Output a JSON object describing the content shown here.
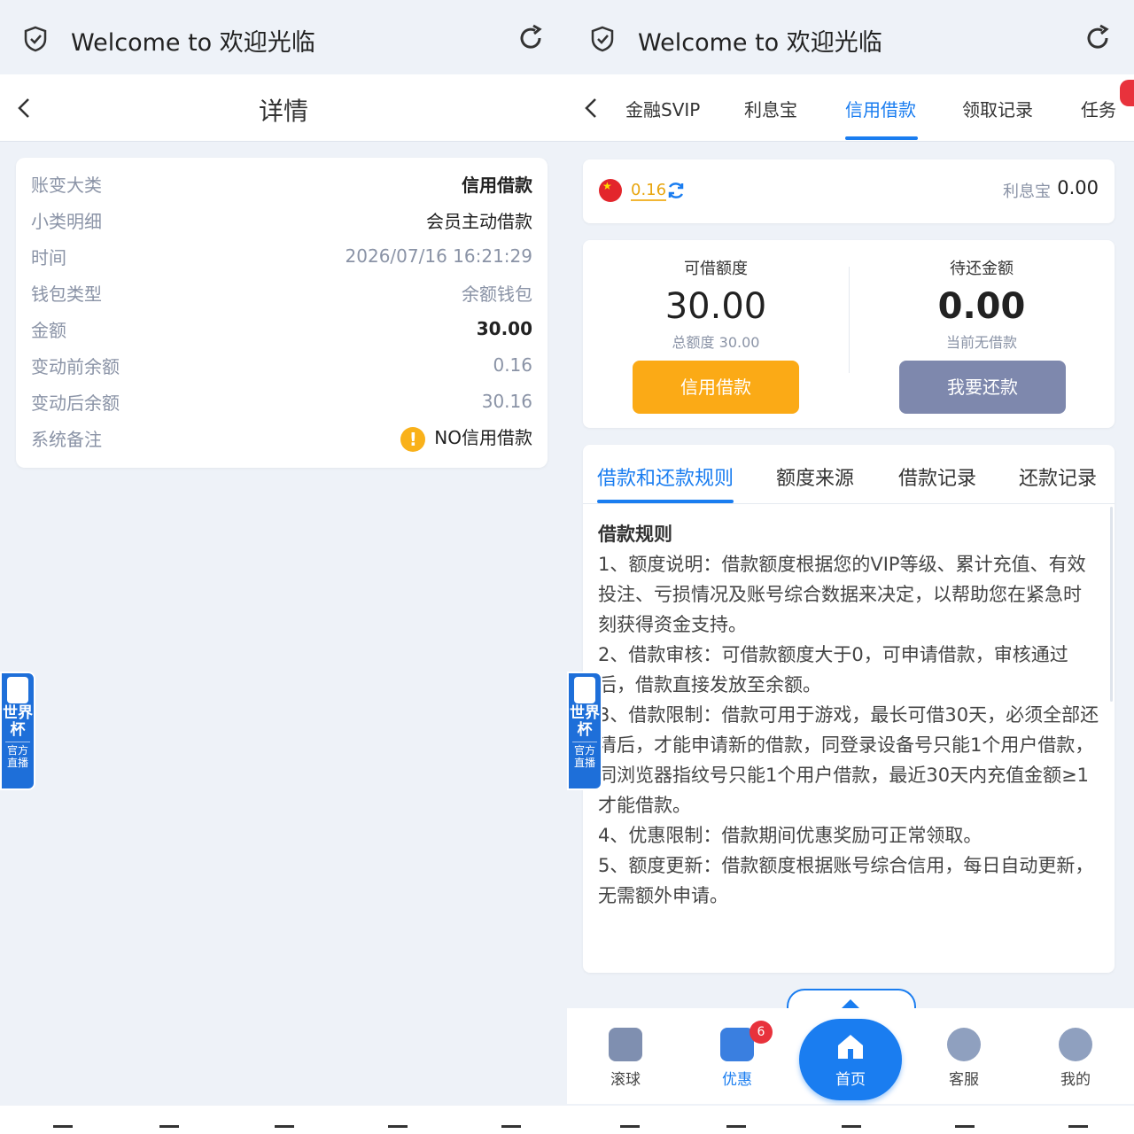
{
  "left": {
    "topbar": {
      "title": "Welcome to 欢迎光临"
    },
    "header": {
      "title": "详情"
    },
    "detail": {
      "rows": [
        {
          "key": "账变大类",
          "value": "信用借款"
        },
        {
          "key": "小类明细",
          "value": "会员主动借款"
        },
        {
          "key": "时间",
          "value": "2026/07/16 16:21:29"
        },
        {
          "key": "钱包类型",
          "value": "余额钱包"
        },
        {
          "key": "金额",
          "value": "30.00"
        },
        {
          "key": "变动前余额",
          "value": "0.16"
        },
        {
          "key": "变动后余额",
          "value": "30.16"
        },
        {
          "key": "系统备注",
          "value": "NO信用借款"
        }
      ]
    },
    "badge": {
      "line1": "世界杯",
      "line2": "官方直播"
    }
  },
  "right": {
    "topbar": {
      "title": "Welcome to 欢迎光临"
    },
    "tabs": [
      "金融SVIP",
      "利息宝",
      "信用借款",
      "领取记录",
      "任务"
    ],
    "active_tab": "信用借款",
    "balance": {
      "value": "0.16",
      "lxb_label": "利息宝",
      "lxb_value": "0.00"
    },
    "loan": {
      "available_label": "可借额度",
      "available_amount": "30.00",
      "total_label": "总额度 30.00",
      "due_label": "待还金额",
      "due_amount": "0.00",
      "due_sub": "当前无借款",
      "borrow_button": "信用借款",
      "repay_button": "我要还款"
    },
    "subtabs": [
      "借款和还款规则",
      "额度来源",
      "借款记录",
      "还款记录"
    ],
    "rules": {
      "title": "借款规则",
      "items": [
        "1、额度说明：借款额度根据您的VIP等级、累计充值、有效投注、亏损情况及账号综合数据来决定，以帮助您在紧急时刻获得资金支持。",
        "2、借款审核：可借款额度大于0，可申请借款，审核通过后，借款直接发放至余额。",
        "3、借款限制：借款可用于游戏，最长可借30天，必须全部还清后，才能申请新的借款，同登录设备号只能1个用户借款，同浏览器指纹号只能1个用户借款，最近30天内充值金额≥1才能借款。",
        "4、优惠限制：借款期间优惠奖励可正常领取。",
        "5、额度更新：借款额度根据账号综合信用，每日自动更新，无需额外申请。"
      ]
    },
    "nav": [
      {
        "label": "滚球",
        "icon": "ball-icon"
      },
      {
        "label": "优惠",
        "icon": "gift-icon",
        "count": "6"
      },
      {
        "label": "首页",
        "icon": "home-icon"
      },
      {
        "label": "客服",
        "icon": "headset-icon"
      },
      {
        "label": "我的",
        "icon": "user-icon"
      }
    ],
    "badge": {
      "line1": "世界杯",
      "line2": "官方直播"
    }
  },
  "colors": {
    "accent": "#1a7df0",
    "orange": "#fbaa16",
    "repay": "#7e88ad",
    "muted": "#8a93a6"
  }
}
